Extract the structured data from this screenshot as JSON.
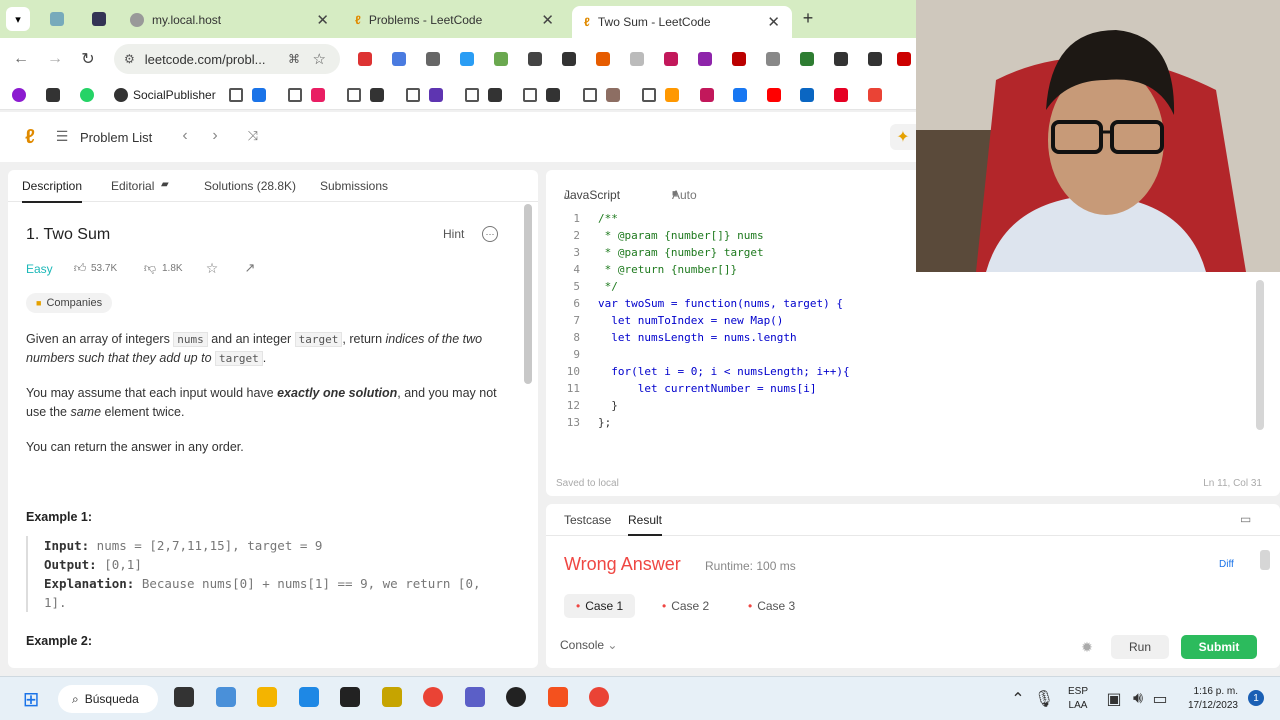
{
  "browser": {
    "tabs": [
      {
        "title": "my.local.host"
      },
      {
        "title": "Problems - LeetCode"
      },
      {
        "title": "Two Sum - LeetCode"
      }
    ],
    "url": "leetcode.com/probl...",
    "bookmarks": {
      "social_publisher": "SocialPublisher"
    }
  },
  "lc_header": {
    "problem_list": "Problem List"
  },
  "left_tabs": {
    "description": "Description",
    "editorial": "Editorial",
    "solutions": "Solutions (28.8K)",
    "submissions": "Submissions"
  },
  "problem": {
    "title": "1. Two Sum",
    "hint": "Hint",
    "difficulty": "Easy",
    "likes": "53.7K",
    "dislikes": "1.8K",
    "companies": "Companies",
    "para1_a": "Given an array of integers ",
    "para1_nums": "nums",
    "para1_b": " and an integer ",
    "para1_target": "target",
    "para1_c": ", return ",
    "para1_d": "indices of the two numbers such that they add up to ",
    "para1_e": "target",
    "para1_f": ".",
    "para2_a": "You may assume that each input would have ",
    "para2_b": "exactly one solution",
    "para2_c": ", and you may not use the ",
    "para2_d": "same",
    "para2_e": " element twice.",
    "para3": "You can return the answer in any order.",
    "example1_title": "Example 1:",
    "ex1_input_label": "Input:",
    "ex1_input": " nums = [2,7,11,15], target = 9",
    "ex1_output_label": "Output:",
    "ex1_output": " [0,1]",
    "ex1_expl_label": "Explanation:",
    "ex1_expl": " Because nums[0] + nums[1] == 9, we return [0, 1].",
    "example2_title": "Example 2:"
  },
  "editor": {
    "language": "JavaScript",
    "mode": "Auto",
    "status": "Saved to local",
    "cursor": "Ln 11, Col 31",
    "lines": [
      {
        "n": "1",
        "t": "/**"
      },
      {
        "n": "2",
        "t": " * @param {number[]} nums"
      },
      {
        "n": "3",
        "t": " * @param {number} target"
      },
      {
        "n": "4",
        "t": " * @return {number[]}"
      },
      {
        "n": "5",
        "t": " */"
      },
      {
        "n": "6",
        "t": "var twoSum = function(nums, target) {"
      },
      {
        "n": "7",
        "t": "  let numToIndex = new Map()"
      },
      {
        "n": "8",
        "t": "  let numsLength = nums.length"
      },
      {
        "n": "9",
        "t": ""
      },
      {
        "n": "10",
        "t": "  for(let i = 0; i < numsLength; i++){"
      },
      {
        "n": "11",
        "t": "      let currentNumber = nums[i]"
      },
      {
        "n": "12",
        "t": "  }"
      },
      {
        "n": "13",
        "t": "};"
      }
    ]
  },
  "result": {
    "tab_testcase": "Testcase",
    "tab_result": "Result",
    "verdict": "Wrong Answer",
    "runtime": "Runtime: 100 ms",
    "diff": "Diff",
    "cases": [
      "Case 1",
      "Case 2",
      "Case 3"
    ],
    "console": "Console",
    "run": "Run",
    "submit": "Submit"
  },
  "taskbar": {
    "search": "Búsqueda",
    "lang1": "ESP",
    "lang2": "LAA",
    "time": "1:16 p. m.",
    "date": "17/12/2023",
    "notif": "1"
  },
  "colors": {
    "accent_green": "#2cbb5d",
    "wrong": "#ef4743",
    "easy": "#1cb8b8"
  }
}
